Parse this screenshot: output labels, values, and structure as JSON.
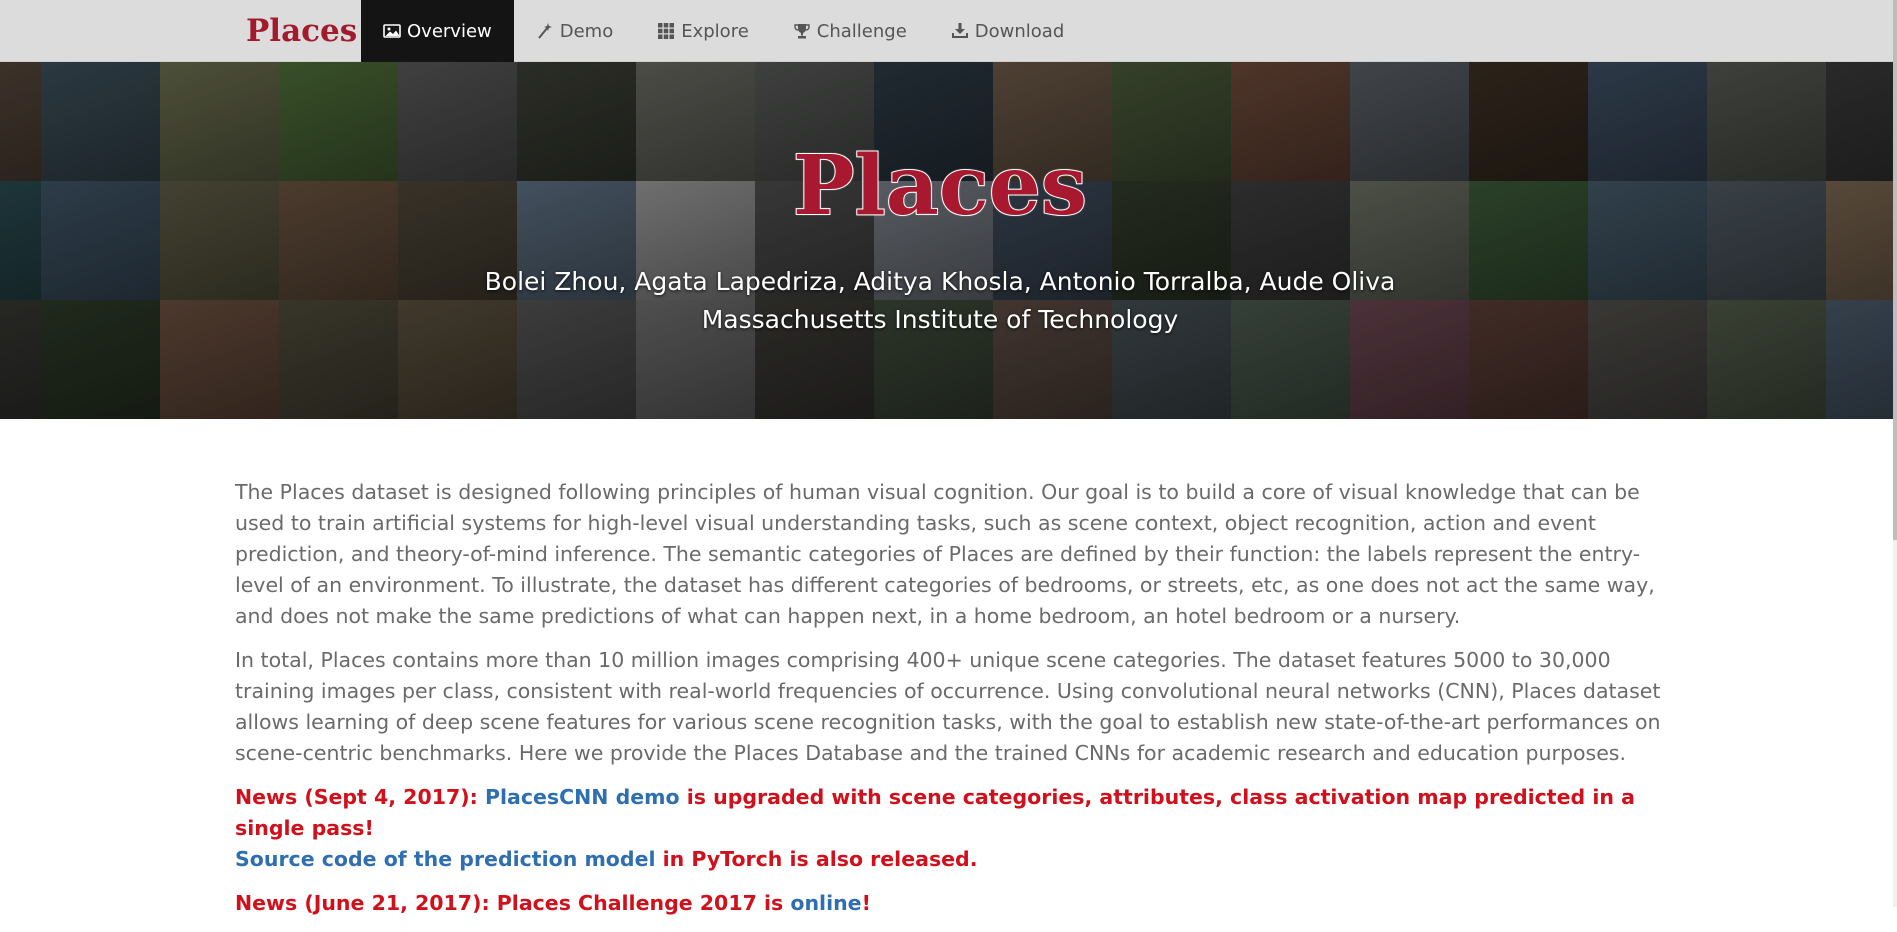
{
  "nav": {
    "brand": "Places",
    "items": [
      {
        "label": "Overview",
        "icon": "image-icon",
        "active": true
      },
      {
        "label": "Demo",
        "icon": "magic-wand-icon",
        "active": false
      },
      {
        "label": "Explore",
        "icon": "grid-icon",
        "active": false
      },
      {
        "label": "Challenge",
        "icon": "trophy-icon",
        "active": false
      },
      {
        "label": "Download",
        "icon": "download-icon",
        "active": false
      }
    ]
  },
  "hero": {
    "title": "Places",
    "authors": "Bolei Zhou, Agata Lapedriza, Aditya Khosla, Antonio Torralba, Aude Oliva",
    "affiliation": "Massachusetts Institute of Technology"
  },
  "content": {
    "paragraph1": "The Places dataset is designed following principles of human visual cognition. Our goal is to build a core of visual knowledge that can be used to train artificial systems for high-level visual understanding tasks, such as scene context, object recognition, action and event prediction, and theory-of-mind inference. The semantic categories of Places are defined by their function: the labels represent the entry-level of an environment. To illustrate, the dataset has different categories of bedrooms, or streets, etc, as one does not act the same way, and does not make the same predictions of what can happen next, in a home bedroom, an hotel bedroom or a nursery.",
    "paragraph2": "In total, Places contains more than 10 million images comprising 400+ unique scene categories. The dataset features 5000 to 30,000 training images per class, consistent with real-world frequencies of occurrence. Using convolutional neural networks (CNN), Places dataset allows learning of deep scene features for various scene recognition tasks, with the goal to establish new state-of-the-art performances on scene-centric benchmarks. Here we provide the Places Database and the trained CNNs for academic research and education purposes.",
    "news1": {
      "prefix": "News (Sept 4, 2017): ",
      "link1": "PlacesCNN demo",
      "middle": " is upgraded with scene categories, attributes, class activation map predicted in a single pass!",
      "link2": "Source code of the prediction model",
      "suffix": " in PyTorch is also released."
    },
    "news2": {
      "prefix": "News (June 21, 2017): Places Challenge 2017 is ",
      "link": "online",
      "suffix": "!"
    }
  },
  "colors": {
    "brand_red": "#a11b2d",
    "news_red": "#d0101a",
    "link_blue": "#2f6fb0",
    "navbar_bg": "#dcdcdc",
    "nav_active_bg": "#141414"
  },
  "tile_colors": [
    "#5b4a3e",
    "#3d4f5a",
    "#6b6f4f",
    "#4f6e3a",
    "#595959",
    "#3c3f35",
    "#6a6a63",
    "#575957",
    "#2e3a45",
    "#6d5a48",
    "#4a5a3a",
    "#6e4a3a",
    "#5a5f66",
    "#3d3024",
    "#3e4f63",
    "#565a52",
    "#3a3a3a",
    "#2c4f55",
    "#3f5466",
    "#5d5b44",
    "#6a5340",
    "#4e4638",
    "#5d6f82",
    "#9a9a9a",
    "#4d4d4d",
    "#7a7f88",
    "#3d4a5a",
    "#323b2b",
    "#3e3e3e",
    "#6a6f62",
    "#3c5a39",
    "#455a6a",
    "#4f5962",
    "#7a6650",
    "#3a3a36",
    "#2d3a28",
    "#6b4f3f",
    "#4e4a3a",
    "#5a4f3d",
    "#545454",
    "#6e6e6e",
    "#3b3a36",
    "#3e4a3a",
    "#5b4a42",
    "#454f54",
    "#4a5a4e",
    "#6a4550",
    "#5a3d35",
    "#4f4e4a",
    "#505a48",
    "#4a5a6a"
  ]
}
